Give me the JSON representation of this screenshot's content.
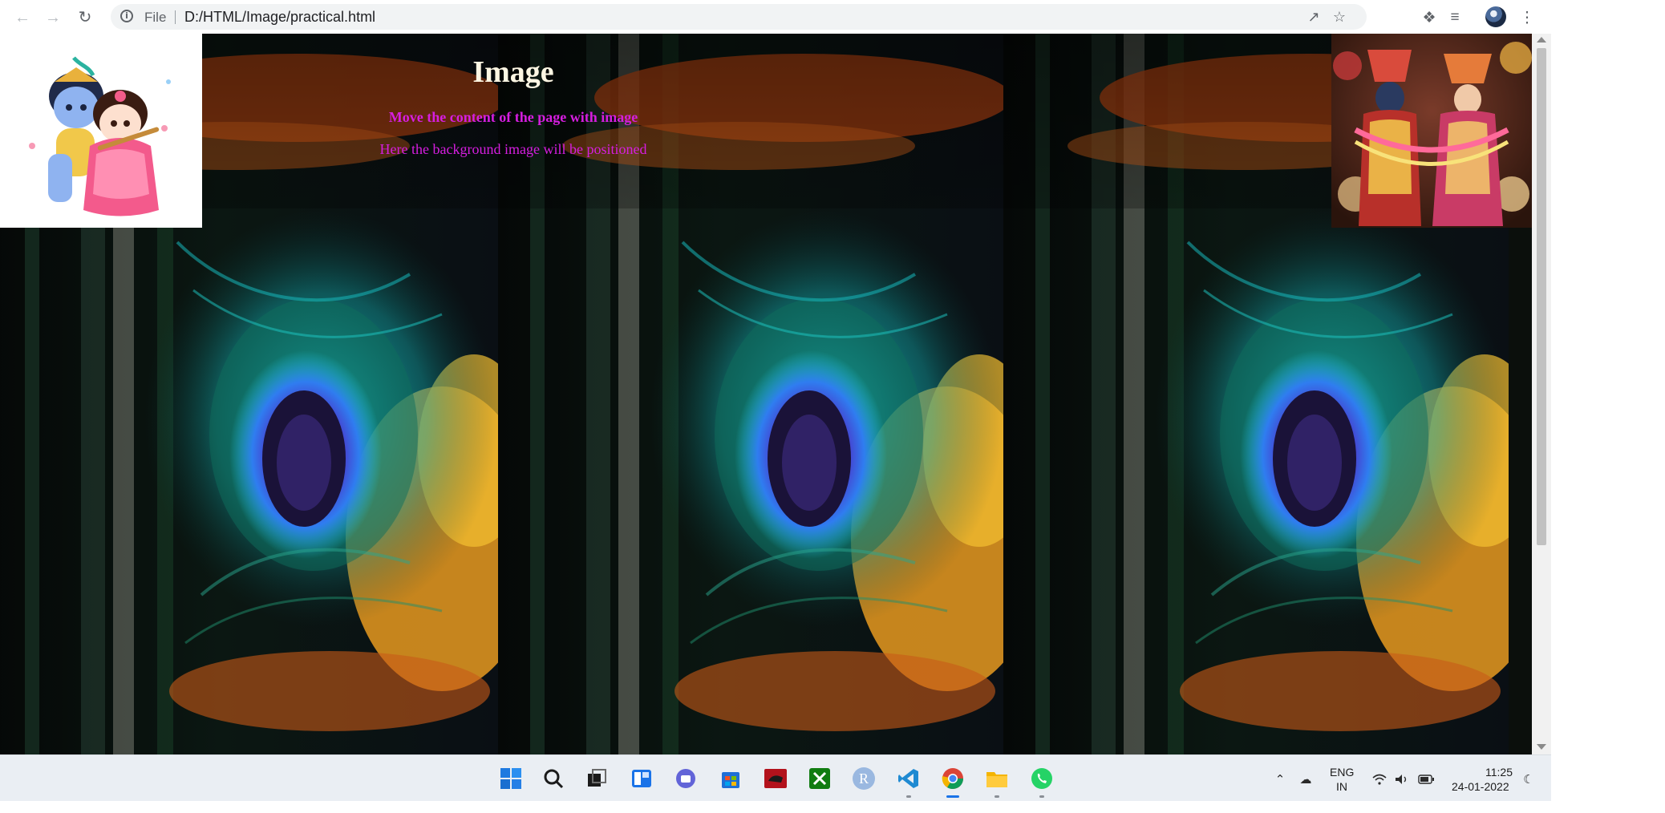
{
  "browser": {
    "scheme_label": "File",
    "url": "D:/HTML/Image/practical.html"
  },
  "page": {
    "heading": "Image",
    "line1": "Move the content of the page with image",
    "line2": "Here the background image will be positioned"
  },
  "colors": {
    "heading": "#fdf6e3",
    "subtext": "#d61ee0",
    "accent": "#1a73e8"
  },
  "taskbar": {
    "language_primary": "ENG",
    "language_secondary": "IN",
    "clock_time": "11:25",
    "clock_date": "24-01-2022",
    "r_app_letter": "R"
  }
}
